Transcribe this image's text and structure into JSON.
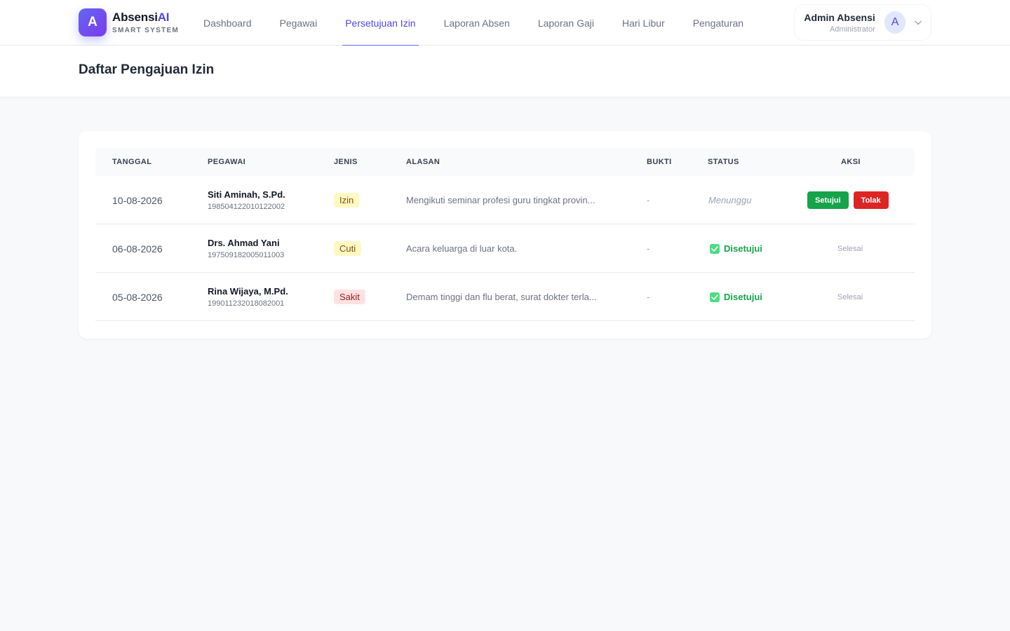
{
  "brand": {
    "logo_letter": "A",
    "name": "Absensi",
    "name_accent": "AI",
    "subtitle": "SMART SYSTEM",
    "accent_color": "#4f46e5"
  },
  "nav": {
    "items": [
      {
        "label": "Dashboard",
        "active": false
      },
      {
        "label": "Pegawai",
        "active": false
      },
      {
        "label": "Persetujuan Izin",
        "active": true
      },
      {
        "label": "Laporan Absen",
        "active": false
      },
      {
        "label": "Laporan Gaji",
        "active": false
      },
      {
        "label": "Hari Libur",
        "active": false
      },
      {
        "label": "Pengaturan",
        "active": false
      }
    ]
  },
  "user": {
    "name": "Admin Absensi",
    "role": "Administrator",
    "avatar_letter": "A",
    "menu_icon": "chevron-down-icon"
  },
  "page": {
    "title": "Daftar Pengajuan Izin"
  },
  "table": {
    "headers": [
      "TANGGAL",
      "PEGAWAI",
      "JENIS",
      "ALASAN",
      "BUKTI",
      "STATUS",
      "AKSI"
    ],
    "rows": [
      {
        "date": "10-08-2026",
        "name": "Siti Aminah, S.Pd.",
        "nip": "198504122010122002",
        "type": "Izin",
        "type_class": "b-izin",
        "reason": "Mengikuti seminar profesi guru tingkat provin...",
        "proof": "-",
        "status": "Menunggu",
        "status_kind": "pending",
        "approve_label": "Setujui",
        "reject_label": "Tolak"
      },
      {
        "date": "06-08-2026",
        "name": "Drs. Ahmad Yani",
        "nip": "197509182005011003",
        "type": "Cuti",
        "type_class": "b-cuti",
        "reason": "Acara keluarga di luar kota.",
        "proof": "-",
        "status": "Disetujui",
        "status_kind": "approved",
        "action_text": "Selesai"
      },
      {
        "date": "05-08-2026",
        "name": "Rina Wijaya, M.Pd.",
        "nip": "199011232018082001",
        "type": "Sakit",
        "type_class": "b-sakit",
        "reason": "Demam tinggi dan flu berat, surat dokter terla...",
        "proof": "-",
        "status": "Disetujui",
        "status_kind": "approved",
        "action_text": "Selesai"
      }
    ]
  },
  "colors": {
    "approve": "#16a34a",
    "reject": "#dc2626",
    "approved_text": "#16a34a",
    "pending_text": "#9ca3af"
  }
}
